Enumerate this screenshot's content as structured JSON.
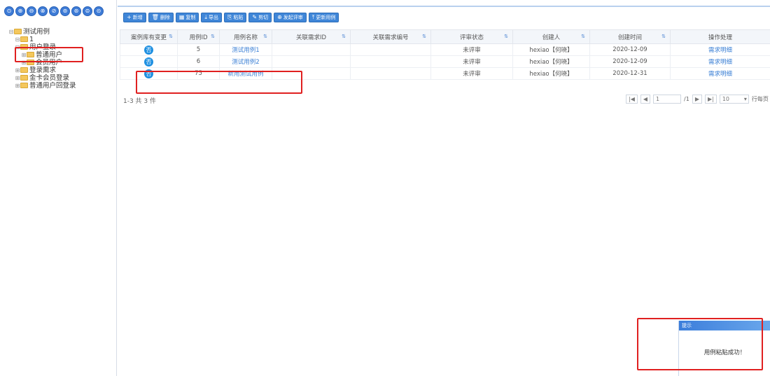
{
  "left_panel": {
    "circle_buttons": [
      "⊙",
      "⊕",
      "⊖",
      "⊗",
      "⊘",
      "⊚",
      "⊛",
      "⊜",
      "⊝"
    ],
    "tree": [
      {
        "label": "测试用例",
        "toggle": "⊟",
        "indent": 0
      },
      {
        "label": "1",
        "toggle": "⊟",
        "indent": 1
      },
      {
        "label": "用户登录",
        "toggle": "⊟",
        "indent": 1
      },
      {
        "label": "普通用户",
        "toggle": "⊞",
        "indent": 2
      },
      {
        "label": "会员用户",
        "toggle": "⊞",
        "indent": 2
      },
      {
        "label": "登录需求",
        "toggle": "⊞",
        "indent": 1
      },
      {
        "label": "金卡会员登录",
        "toggle": "⊞",
        "indent": 1
      },
      {
        "label": "普通用户回登录",
        "toggle": "⊞",
        "indent": 1
      }
    ]
  },
  "toolbar": {
    "buttons": [
      {
        "icon": "+",
        "label": "新增"
      },
      {
        "icon": "🗑",
        "label": "删除"
      },
      {
        "icon": "▦",
        "label": "复制"
      },
      {
        "icon": "⤓",
        "label": "导出"
      },
      {
        "icon": "⎘",
        "label": "粘贴"
      },
      {
        "icon": "✎",
        "label": "剪切"
      },
      {
        "icon": "⊕",
        "label": "发起评审"
      },
      {
        "icon": "⤒",
        "label": "更新用例"
      }
    ]
  },
  "table": {
    "sort_icon": "⇅",
    "columns": [
      "案例库有变更",
      "用例ID",
      "用例名称",
      "关联需求ID",
      "关联需求编号",
      "评审状态",
      "创建人",
      "创建时间",
      "操作处理"
    ],
    "rows": [
      {
        "badge": "否",
        "id": "5",
        "name": "测试用例1",
        "req_id": "",
        "req_no": "",
        "status": "未评审",
        "creator": "hexiao【何晓】",
        "created": "2020-12-09",
        "action": "需求明细"
      },
      {
        "badge": "否",
        "id": "6",
        "name": "测试用例2",
        "req_id": "",
        "req_no": "",
        "status": "未评审",
        "creator": "hexiao【何晓】",
        "created": "2020-12-09",
        "action": "需求明细"
      },
      {
        "badge": "否",
        "id": "75",
        "name": "新用测试用例",
        "req_id": "",
        "req_no": "",
        "status": "未评审",
        "creator": "hexiao【何晓】",
        "created": "2020-12-31",
        "action": "需求明细"
      }
    ]
  },
  "summary": "1-3 共 3 件",
  "pager": {
    "first": "|◀",
    "prev": "◀",
    "page_value": "1",
    "of_pages": "/1",
    "next": "▶",
    "last": "▶|",
    "page_size": "10",
    "dropdown": "▾",
    "rows_per_page_label": "行每页"
  },
  "toast": {
    "title": "提示",
    "message": "用例粘贴成功！"
  }
}
